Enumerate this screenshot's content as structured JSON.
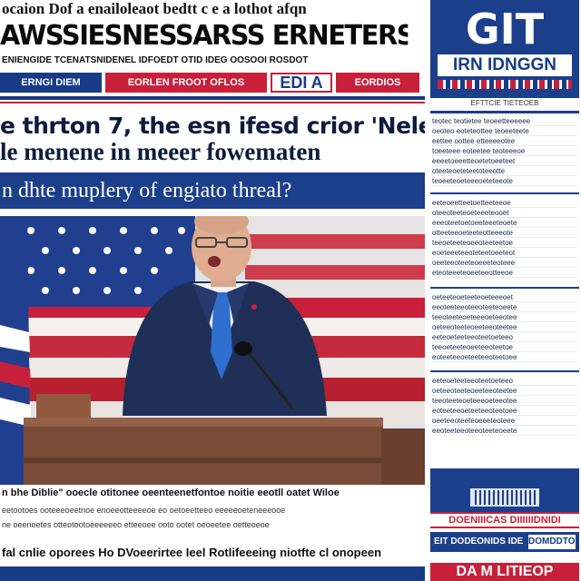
{
  "main": {
    "kicker": "ocaion Dof a enailoleaot bedtt c e a lothot afqn",
    "masthead": "AWSSIESNESSARSS ERNETERS NNIGENT",
    "subline": "ENIENGIDE TCENATSNIDENEL IDFOEDT OTID IDEG OOSOOI ROSDOT",
    "nav": [
      {
        "label": "ERNGI DIEM"
      },
      {
        "label": "EORLEN FROOT OFLOS"
      },
      {
        "label": "EDI A"
      },
      {
        "label": "EORDIOS"
      }
    ],
    "headline1": "e thrton 7, the esn ifesd crior 'Nele",
    "headline2": "le menene in meeer fowematen",
    "question": "n dhte muplery of engiato threal?",
    "bottom_caption": "n bhe Diblie\" ooecle otitonee oeenteenetfontoe noitie eeotll oatet Wiloe",
    "body_lines": [
      "eetootoes ooteeeoeetnoe enoeeotteeeeoe eo oetoeetteeo eeeeeoeteneeeooe",
      "ne oeenoetes otteotootoeeeeeeo etteeoee ooto ootet oeoeetee oetteoeoe"
    ],
    "footer": "fal cnlie oporees Ho DVoeerirtee Ieel Rotlifeeeing niotfte cl onopeen"
  },
  "sidebar": {
    "logo_big": "GIT",
    "logo_sub": "IRN IDNGGN",
    "caption": "EFTTCIE TIETEOEB",
    "block1": [
      "teotec teotietee teoeetteeeeee",
      "oeoteo eoteteottee teoeeteete",
      "eettee oottee etteeeeotee",
      "toeeteee eoteetee teoteeeoe",
      "eeeetoeeetteoetetoeeteet",
      "oteeteoeteteetoteeotte",
      "teoeeteoeteeeoeteteeote"
    ],
    "block2": [
      "eeteoeetteetoetteeteeoe",
      "oteeoteeteoeteeeteooet",
      "eeeoteetoetoeeteeeteoete",
      "otteeteeoeteeteotteeeote",
      "teeoeteeteoeeoteeteetoe",
      "eoeteeeteeoteteetoeeteot",
      "oeeteeoteeteoeeeteoteee",
      "eteoteeeteoeeteeotteeoe"
    ],
    "block3": [
      "oeteeteoeteeteoeteeeoet",
      "eeoteeteeoteeoteeteoeete",
      "teeoteeteoeteeeoeteeotee",
      "oeteeoteeteoeeteeoteetee",
      "eeteoeteeteeoteetoeteeo",
      "teeoeteeteoeeteeoteetoe",
      "eoteeteeoeteeteeoteetoee"
    ],
    "block4": [
      "eeteoeteeteeoteetoeteeo",
      "oeteeoteeteoeeteeoteetee",
      "teeoteeteoeteeeoeteeotee",
      "eoteeteeoeteeteeoteetoee",
      "oeeteeoteeteoeeeteoteee",
      "eeoteeteeoteeoteeteoeete"
    ],
    "banner_red": "DOENIIICAS DIIIIIIDNIDI",
    "banner_blue": "EIT DODEONIDS IDE",
    "banner_tag": "DOMDDTOD",
    "footer": "DA M LITIEOP"
  },
  "colors": {
    "navy": "#173b86",
    "blue": "#1c3f8c",
    "red": "#c8203a"
  }
}
